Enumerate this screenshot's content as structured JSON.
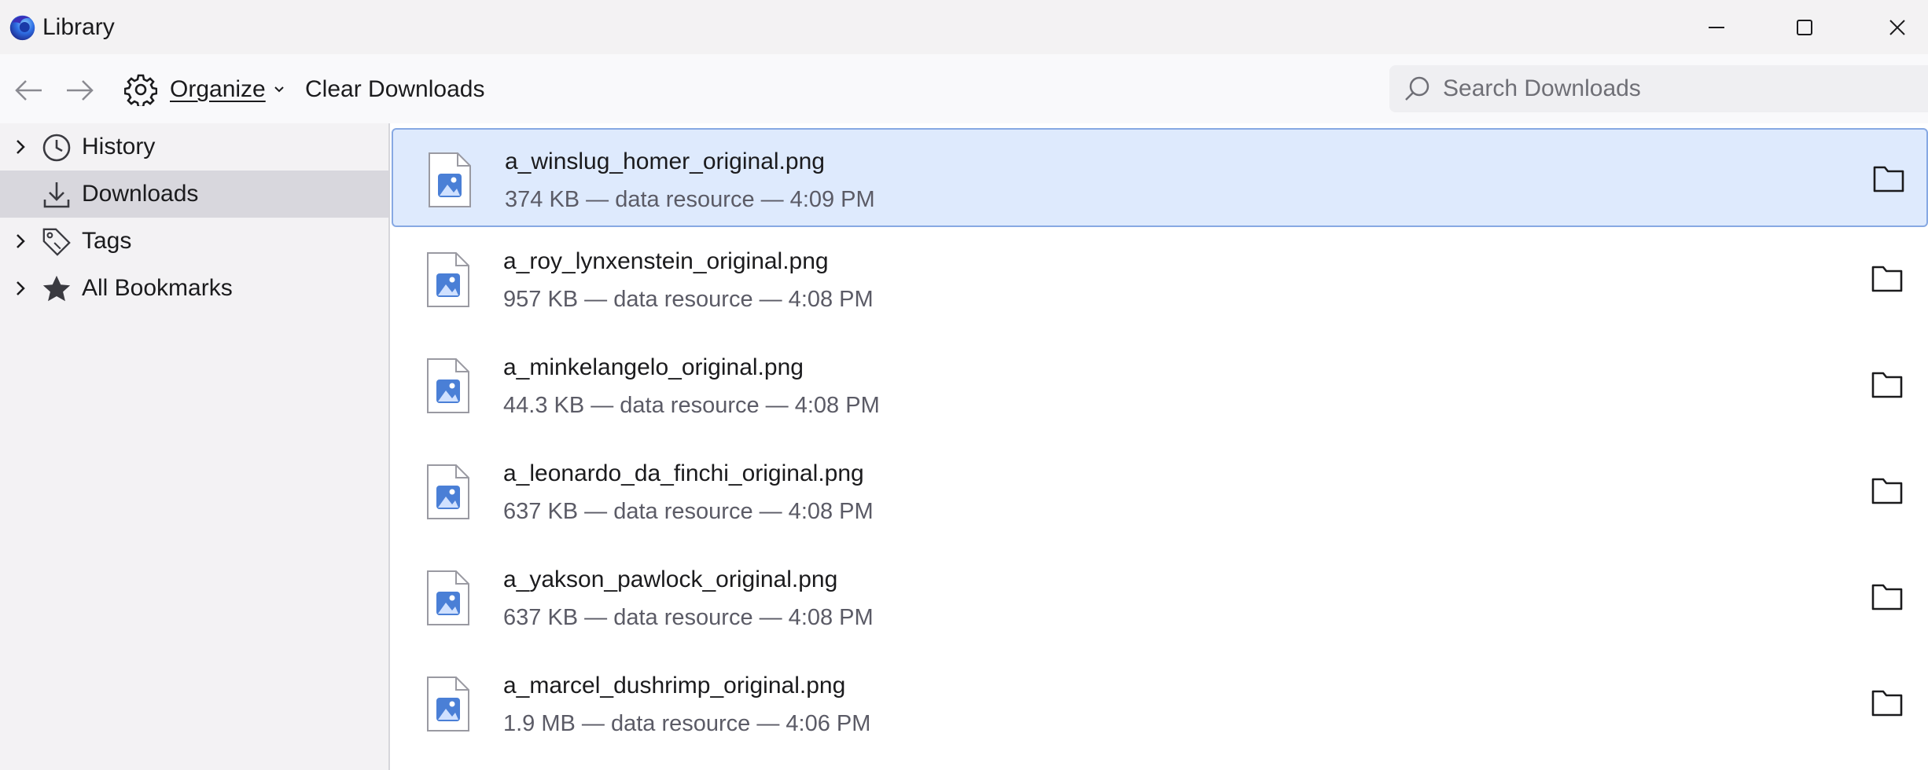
{
  "window": {
    "title": "Library",
    "minimize_icon": "minimize-icon",
    "maximize_icon": "maximize-icon",
    "close_icon": "close-icon"
  },
  "toolbar": {
    "back_icon": "arrow-left-icon",
    "forward_icon": "arrow-right-icon",
    "organize_label": "Organize",
    "organize_icon": "gear-icon",
    "clear_label": "Clear Downloads",
    "search_placeholder": "Search Downloads",
    "search_icon": "search-icon"
  },
  "sidebar": {
    "items": [
      {
        "label": "History",
        "icon": "clock-icon",
        "expandable": true,
        "selected": false
      },
      {
        "label": "Downloads",
        "icon": "download-icon",
        "expandable": false,
        "selected": true
      },
      {
        "label": "Tags",
        "icon": "tag-icon",
        "expandable": true,
        "selected": false
      },
      {
        "label": "All Bookmarks",
        "icon": "star-icon",
        "expandable": true,
        "selected": false
      }
    ]
  },
  "downloads": [
    {
      "name": "a_winslug_homer_original.png",
      "meta": "374 KB — data resource — 4:09 PM",
      "selected": true
    },
    {
      "name": "a_roy_lynxenstein_original.png",
      "meta": "957 KB — data resource — 4:08 PM",
      "selected": false
    },
    {
      "name": "a_minkelangelo_original.png",
      "meta": "44.3 KB — data resource — 4:08 PM",
      "selected": false
    },
    {
      "name": "a_leonardo_da_finchi_original.png",
      "meta": "637 KB — data resource — 4:08 PM",
      "selected": false
    },
    {
      "name": "a_yakson_pawlock_original.png",
      "meta": "637 KB — data resource — 4:08 PM",
      "selected": false
    },
    {
      "name": "a_marcel_dushrimp_original.png",
      "meta": "1.9 MB — data resource — 4:06 PM",
      "selected": false
    }
  ],
  "colors": {
    "accent": "#4a7fd6",
    "selection_bg": "#deeafd",
    "selection_border": "#87a9e3"
  }
}
